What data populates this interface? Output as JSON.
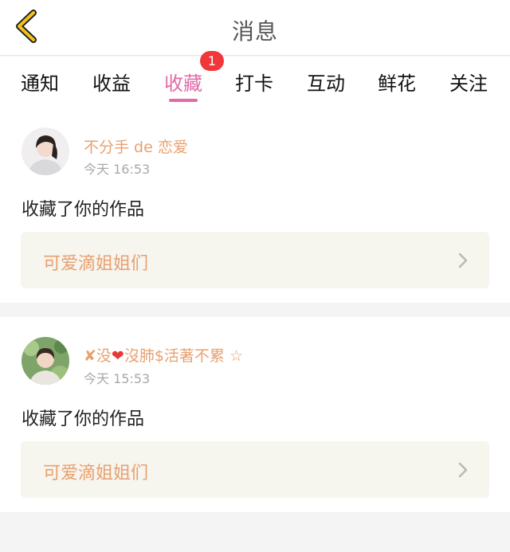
{
  "header": {
    "title": "消息"
  },
  "tabs": [
    {
      "label": "通知"
    },
    {
      "label": "收益"
    },
    {
      "label": "收藏",
      "active": true,
      "badge": "1"
    },
    {
      "label": "打卡"
    },
    {
      "label": "互动"
    },
    {
      "label": "鲜花"
    },
    {
      "label": "关注"
    }
  ],
  "messages": [
    {
      "user_name": "不分手 de 恋爱",
      "time": "今天 16:53",
      "action": "收藏了你的作品",
      "work_title": "可爱滴姐姐们"
    },
    {
      "user_name_prefix": "✘没",
      "user_name_heart": "❤",
      "user_name_suffix": "沒肺$活著不累 ☆",
      "time": "今天 15:53",
      "action": "收藏了你的作品",
      "work_title": "可爱滴姐姐们"
    }
  ],
  "colors": {
    "accent_pink": "#e26aa6",
    "name_orange": "#e8a070",
    "badge_red": "#f0383b",
    "work_bg": "#f6f5ee"
  },
  "icons": {
    "back": "chevron-left-icon",
    "work_arrow": "chevron-right-icon"
  }
}
